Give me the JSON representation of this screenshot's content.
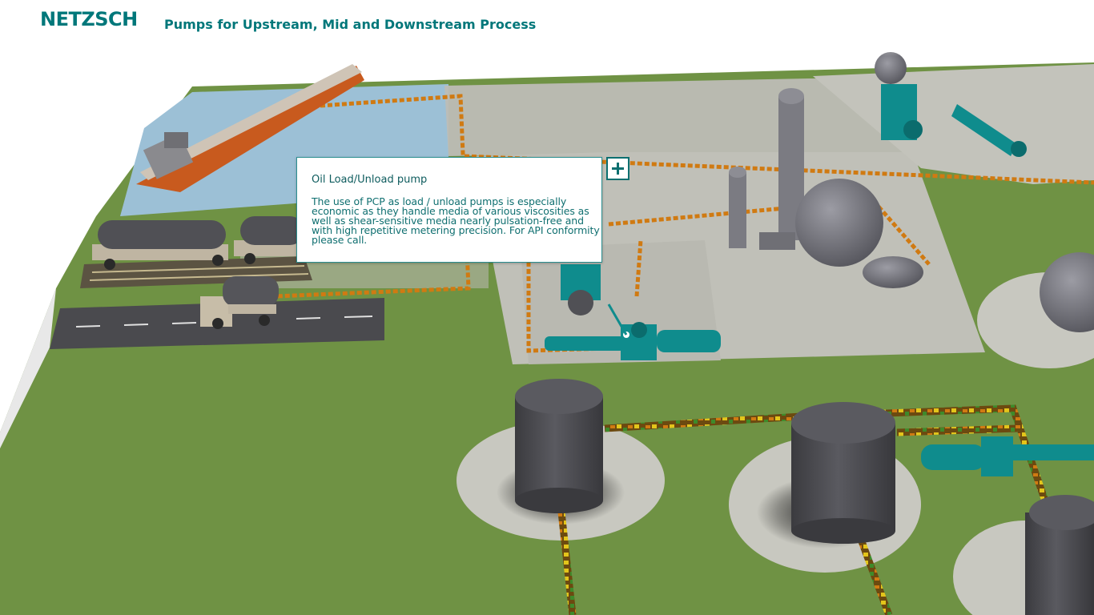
{
  "header": {
    "logo": "NETZSCH",
    "title": "Pumps for Upstream, Mid and Downstream Process"
  },
  "popup": {
    "title": "Oil Load/Unload pump",
    "body": "The use of PCP as load / unload pumps is especially economic as they handle media of various viscosities as well as  shear-sensitive  media nearly pulsation-free and with high repetitive metering precision. For API conformity please call.",
    "expand_icon": "plus-icon"
  },
  "colors": {
    "brand": "#00777a",
    "grass": "#6f9244",
    "concrete": "#bcbcb4",
    "pump": "#0f8c8d",
    "tank": "#4a4a4e",
    "pipe": "#d07a12"
  }
}
